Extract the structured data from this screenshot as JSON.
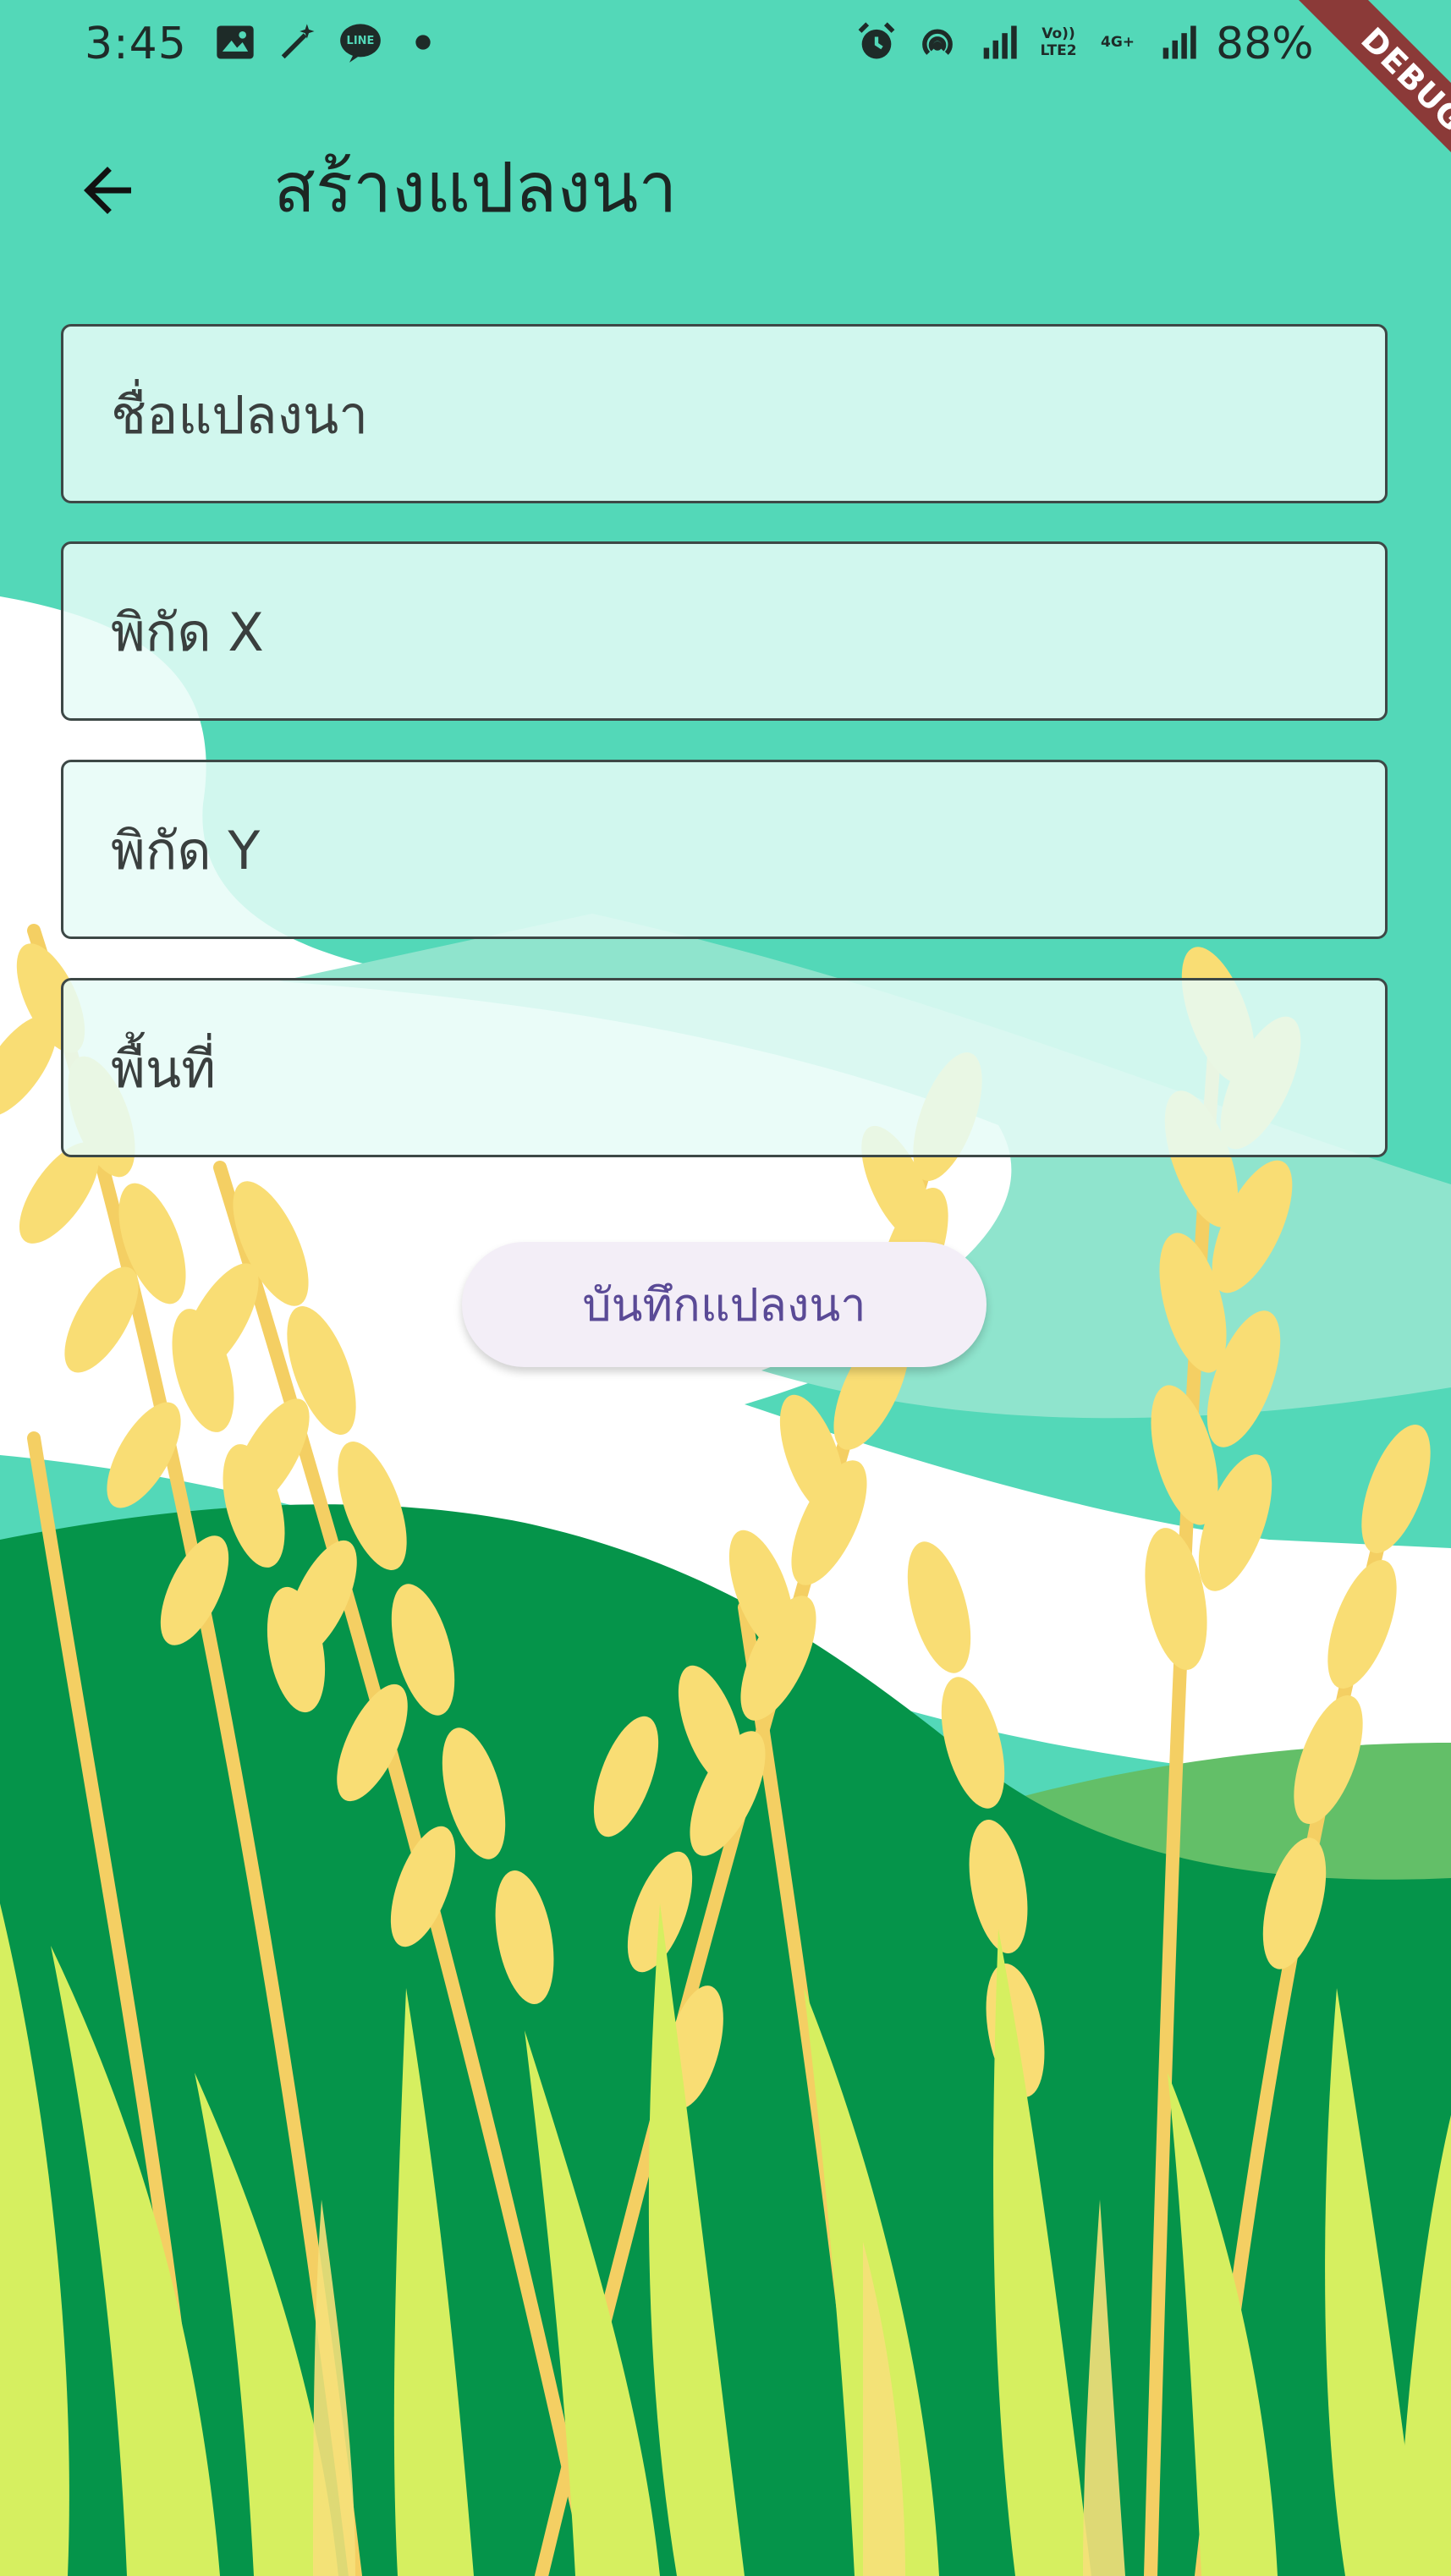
{
  "status_bar": {
    "time": "3:45",
    "battery": "88%",
    "network_label_1": "Vo))\nLTE2",
    "network_label_2": "4G+",
    "left_icons": [
      "image-icon",
      "magic-wand-icon",
      "line-app-icon",
      "dot-icon"
    ],
    "right_icons": [
      "alarm-icon",
      "hotspot-icon",
      "signal-icon",
      "volte-icon",
      "4g-icon",
      "signal-icon-2"
    ]
  },
  "debug_banner": "DEBUG",
  "app_bar": {
    "back_icon": "arrow-left-icon",
    "title": "สร้างแปลงนา"
  },
  "form": {
    "name_placeholder": "ชื่อแปลงนา",
    "x_placeholder": "พิกัด X",
    "y_placeholder": "พิกัด Y",
    "area_placeholder": "พื้นที่",
    "save_label": "บันทึกแปลงนา"
  },
  "colors": {
    "sky": "#53d8b8",
    "cloud": "#ffffff",
    "hill": "#05944a",
    "wheat": "#f9dd74",
    "grass": "#d6ef60",
    "button_text": "#5a4a96"
  }
}
